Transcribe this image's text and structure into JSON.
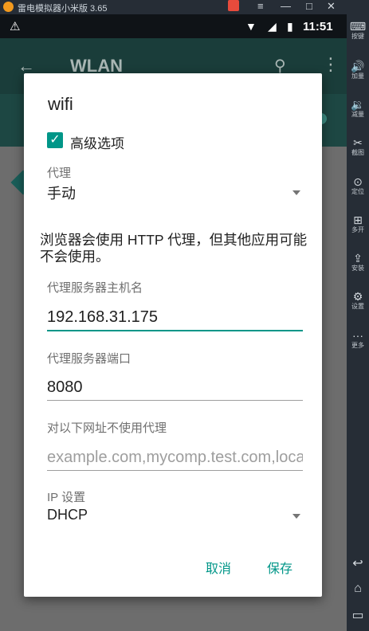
{
  "emulator": {
    "title": "雷电模拟器小米版 3.65",
    "window_controls": [
      "≡",
      "—",
      "□",
      "✕",
      "《"
    ],
    "sidebar": [
      {
        "icon": "keyboard-icon",
        "glyph": "⌨",
        "label": "按键"
      },
      {
        "icon": "volume-up-icon",
        "glyph": "🔊",
        "label": "加量"
      },
      {
        "icon": "volume-down-icon",
        "glyph": "🔉",
        "label": "减量"
      },
      {
        "icon": "scissors-icon",
        "glyph": "✂",
        "label": "截图"
      },
      {
        "icon": "location-icon",
        "glyph": "⊙",
        "label": "定位"
      },
      {
        "icon": "multi-instance-icon",
        "glyph": "⊞",
        "label": "多开"
      },
      {
        "icon": "apk-install-icon",
        "glyph": "⇪",
        "label": "安装"
      },
      {
        "icon": "settings-gear-icon",
        "glyph": "⚙",
        "label": "设置"
      },
      {
        "icon": "more-dots-icon",
        "glyph": "···",
        "label": "更多"
      }
    ],
    "nav": [
      "↩",
      "⌂",
      "▭"
    ]
  },
  "statusbar": {
    "time": "11:51"
  },
  "appbar": {
    "title": "WLAN"
  },
  "dialog": {
    "title": "wifi",
    "advanced_label": "高级选项",
    "proxy_label": "代理",
    "proxy_value": "手动",
    "note": "浏览器会使用 HTTP 代理，但其他应用可能不会使用。",
    "host_label": "代理服务器主机名",
    "host_value": "192.168.31.175",
    "port_label": "代理服务器端口",
    "port_value": "8080",
    "bypass_label": "对以下网址不使用代理",
    "bypass_placeholder": "example.com,mycomp.test.com,localhost",
    "ip_label": "IP 设置",
    "ip_value": "DHCP",
    "cancel": "取消",
    "save": "保存"
  },
  "colors": {
    "accent": "#009688"
  }
}
